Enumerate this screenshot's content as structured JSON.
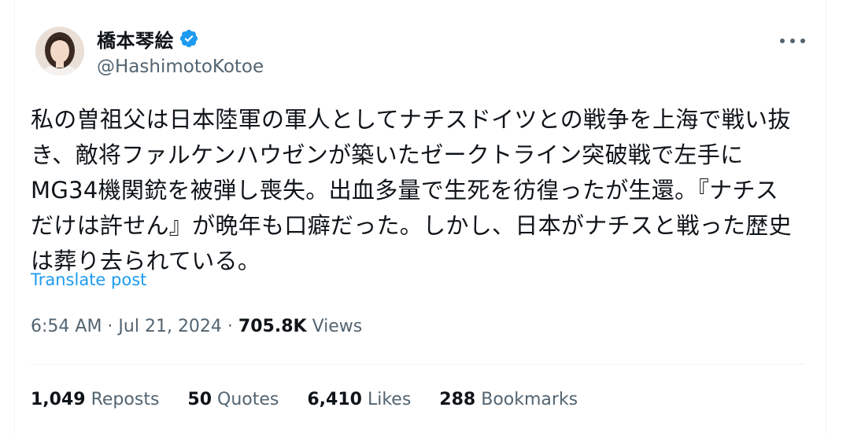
{
  "author": {
    "display_name": "橋本琴絵",
    "handle": "@HashimotoKotoe",
    "verified": true,
    "avatar_icon": "profile-photo"
  },
  "tweet": {
    "lines": [
      "私の曽祖父は日本陸軍の軍人としてナチスドイツとの戦争を上海で戦い抜",
      "き、敵将ファルケンハウゼンが築いたゼークトライン突破戦で左手に",
      "MG34機関銃を被弾し喪失。出血多量で生死を彷徨ったが生還。『ナチス",
      "だけは許せん』が晩年も口癖だった。しかし、日本がナチスと戦った歴史",
      "は葬り去られている。"
    ],
    "translate_label": "Translate post"
  },
  "meta": {
    "time": "6:54 AM",
    "separator": " · ",
    "date": "Jul 21, 2024",
    "views_count": "705.8K",
    "views_label": "Views"
  },
  "stats": [
    {
      "count": "1,049",
      "label": "Reposts"
    },
    {
      "count": "50",
      "label": "Quotes"
    },
    {
      "count": "6,410",
      "label": "Likes"
    },
    {
      "count": "288",
      "label": "Bookmarks"
    }
  ],
  "colors": {
    "link": "#1d9bf0",
    "secondary_text": "#536471",
    "primary_text": "#0f1419",
    "divider": "#eff3f4",
    "verified_badge": "#1d9bf0"
  }
}
